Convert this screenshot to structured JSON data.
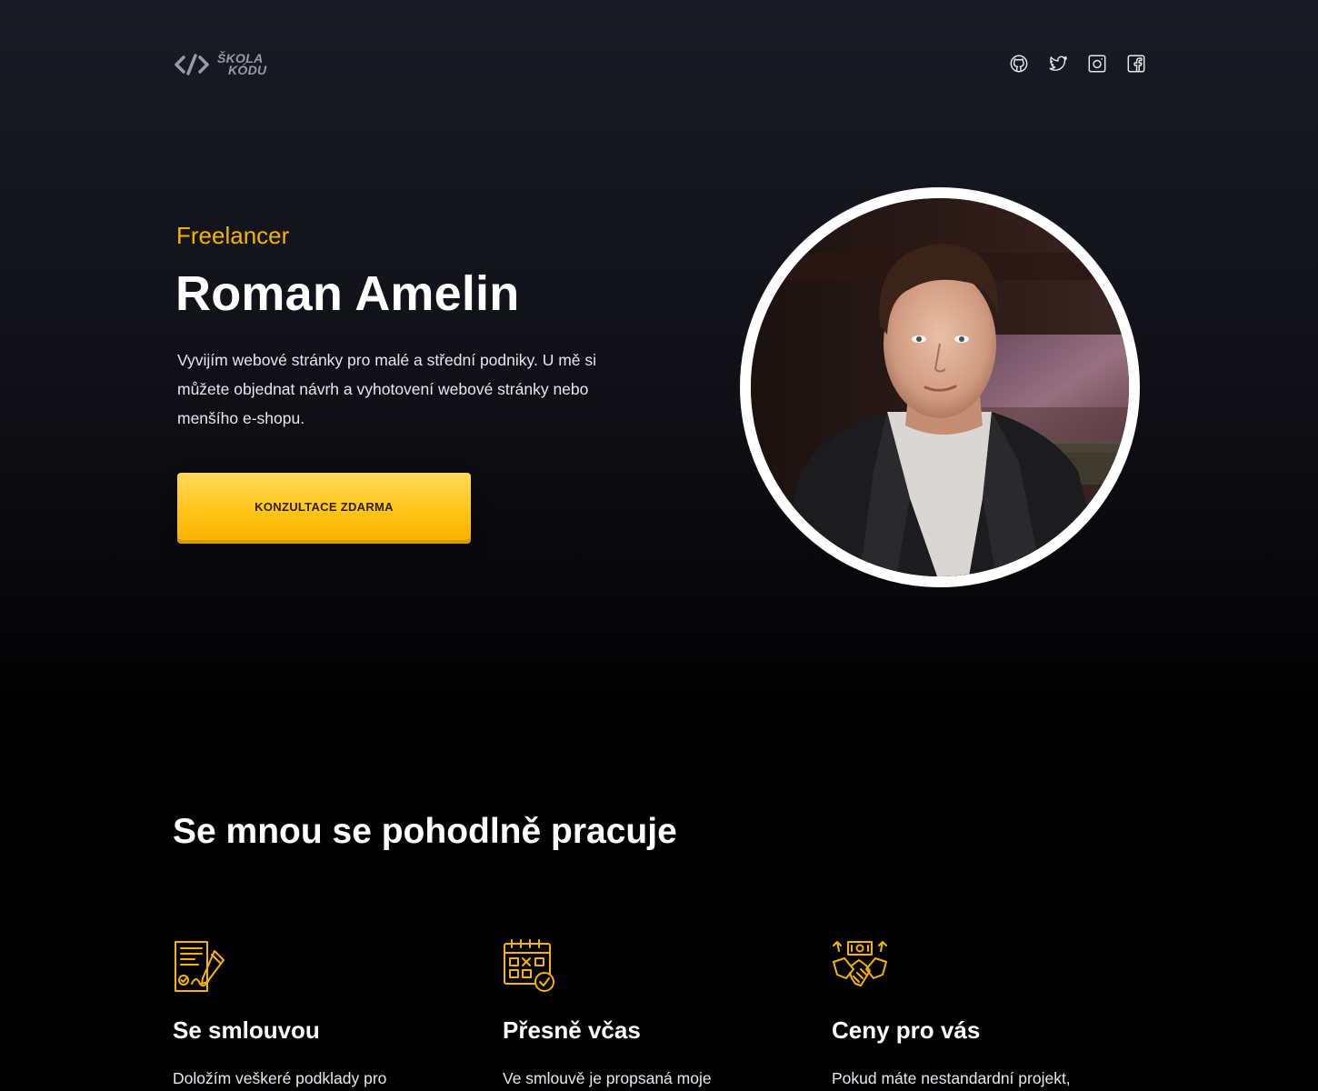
{
  "header": {
    "logo_line1": "ŠKOLA",
    "logo_line2": "KÓDU",
    "socials": [
      {
        "icon": "github-icon"
      },
      {
        "icon": "twitter-icon"
      },
      {
        "icon": "instagram-icon"
      },
      {
        "icon": "facebook-icon"
      }
    ]
  },
  "hero": {
    "eyebrow": "Freelancer",
    "name": "Roman Amelin",
    "description": "Vyvijím webové stránky pro malé a střední podniky. U mě si můžete objednat návrh a vyhotovení webové stránky nebo menšího e-shopu.",
    "cta_label": "KONZULTACE ZDARMA",
    "portrait_icon": "portrait-photo"
  },
  "features": {
    "title": "Se mnou se pohodlně pracuje",
    "items": [
      {
        "icon": "contract-icon",
        "title": "Se smlouvou",
        "text": "Doložím veškeré podklady pro"
      },
      {
        "icon": "calendar-clock-icon",
        "title": "Přesně včas",
        "text": "Ve smlouvě je propsaná moje"
      },
      {
        "icon": "handshake-money-icon",
        "title": "Ceny pro vás",
        "text": "Pokud máte nestandardní projekt,"
      }
    ]
  },
  "colors": {
    "accent": "#f5b400",
    "cta": "#ffc51a",
    "background": "#000000",
    "hero_top": "#1a1a24"
  }
}
